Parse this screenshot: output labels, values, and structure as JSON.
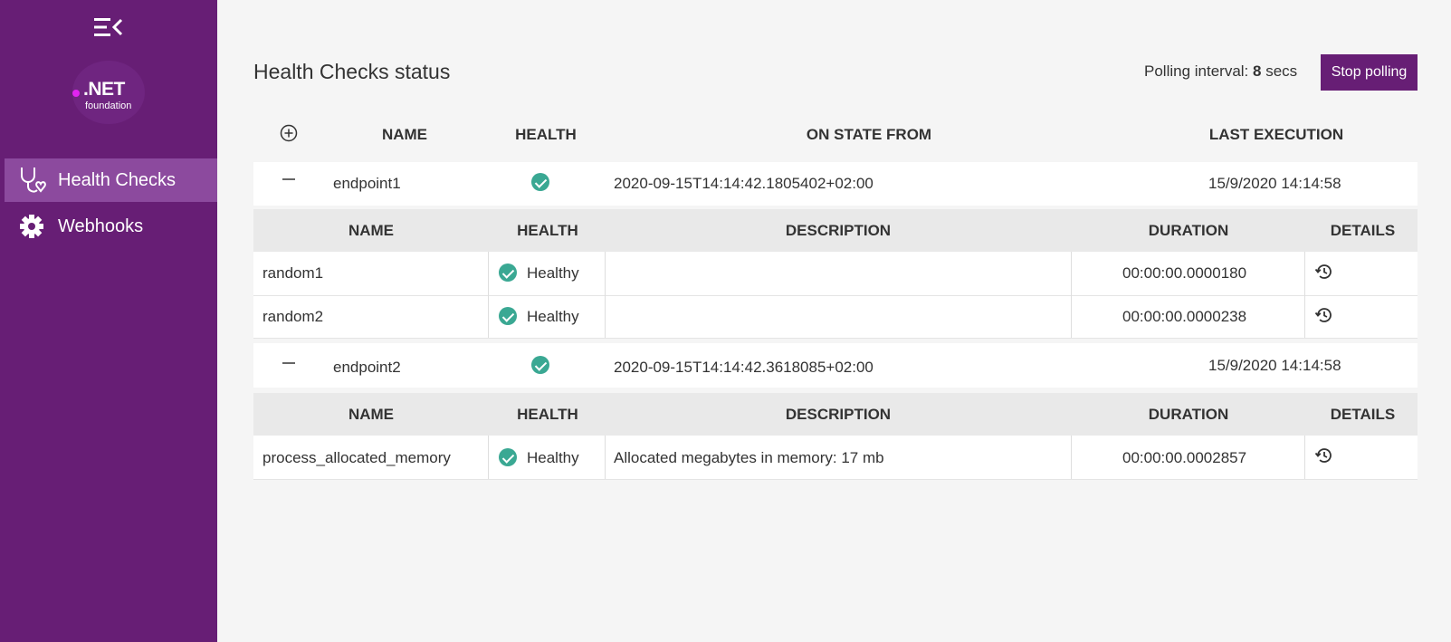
{
  "sidebar": {
    "items": [
      {
        "label": "Health Checks",
        "icon": "stethoscope-icon",
        "active": true
      },
      {
        "label": "Webhooks",
        "icon": "gear-icon",
        "active": false
      }
    ],
    "logo": {
      "name": ".NET",
      "sub": "foundation"
    }
  },
  "header": {
    "title": "Health Checks status",
    "polling_label": "Polling interval:",
    "polling_value": "8",
    "polling_unit": "secs",
    "stop_button": "Stop polling"
  },
  "table": {
    "columns": [
      "NAME",
      "HEALTH",
      "ON STATE FROM",
      "LAST EXECUTION"
    ],
    "sub_columns": [
      "NAME",
      "HEALTH",
      "DESCRIPTION",
      "DURATION",
      "DETAILS"
    ],
    "endpoints": [
      {
        "name": "endpoint1",
        "health": "Healthy",
        "on_state_from": "2020-09-15T14:14:42.1805402+02:00",
        "last_execution": "15/9/2020 14:14:58",
        "entries": [
          {
            "name": "random1",
            "health": "Healthy",
            "description": "",
            "duration": "00:00:00.0000180"
          },
          {
            "name": "random2",
            "health": "Healthy",
            "description": "",
            "duration": "00:00:00.0000238"
          }
        ]
      },
      {
        "name": "endpoint2",
        "health": "Healthy",
        "on_state_from": "2020-09-15T14:14:42.3618085+02:00",
        "last_execution": "15/9/2020 14:14:58",
        "entries": [
          {
            "name": "process_allocated_memory",
            "health": "Healthy",
            "description": "Allocated megabytes in memory: 17 mb",
            "duration": "00:00:00.0002857"
          }
        ]
      }
    ]
  },
  "colors": {
    "brand": "#671e75",
    "active_nav": "#8c4a9e",
    "healthy": "#3aa893"
  }
}
